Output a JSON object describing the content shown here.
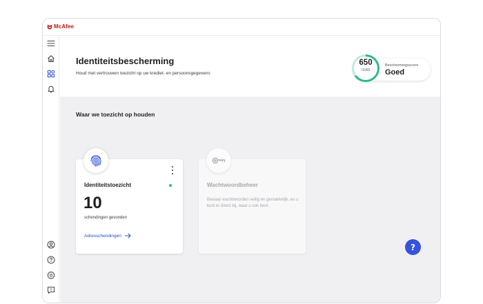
{
  "app": {
    "brand": "McAfee",
    "brand_color": "#c01818",
    "accent_color": "#3553dc",
    "status_color": "#2db88a"
  },
  "sidebar": {
    "top_items": [
      {
        "icon": "menu-icon"
      },
      {
        "icon": "home-icon"
      },
      {
        "icon": "dashboard-grid-icon",
        "active": true
      },
      {
        "icon": "bell-icon"
      }
    ],
    "bottom_items": [
      {
        "icon": "account-icon"
      },
      {
        "icon": "help-circle-icon"
      },
      {
        "icon": "settings-gear-icon"
      },
      {
        "icon": "feedback-icon"
      }
    ]
  },
  "header": {
    "title": "Identiteitsbescherming",
    "subtitle": "Houd met vertrouwen toezicht op uw krediet- en persoonsgegevens"
  },
  "score": {
    "value": "650",
    "max": "/1000",
    "label": "Beschermingsscore",
    "rating": "Goed",
    "fraction": 0.65
  },
  "section": {
    "title": "Waar we toezicht op houden"
  },
  "cards": {
    "identity": {
      "icon": "fingerprint-icon",
      "title": "Identiteitstoezicht",
      "count": "10",
      "count_label": "schendingen gevonden",
      "link": "Adresschendingen"
    },
    "passwords": {
      "icon": "key-icon",
      "title": "Wachtwoordbeheer",
      "description": "Bewaar wachtwoorden veilig en gemakkelijk, en u kunt er direct bij, waar u ook bent."
    }
  },
  "help_button": {
    "icon": "question-mark-icon",
    "label": "?"
  }
}
